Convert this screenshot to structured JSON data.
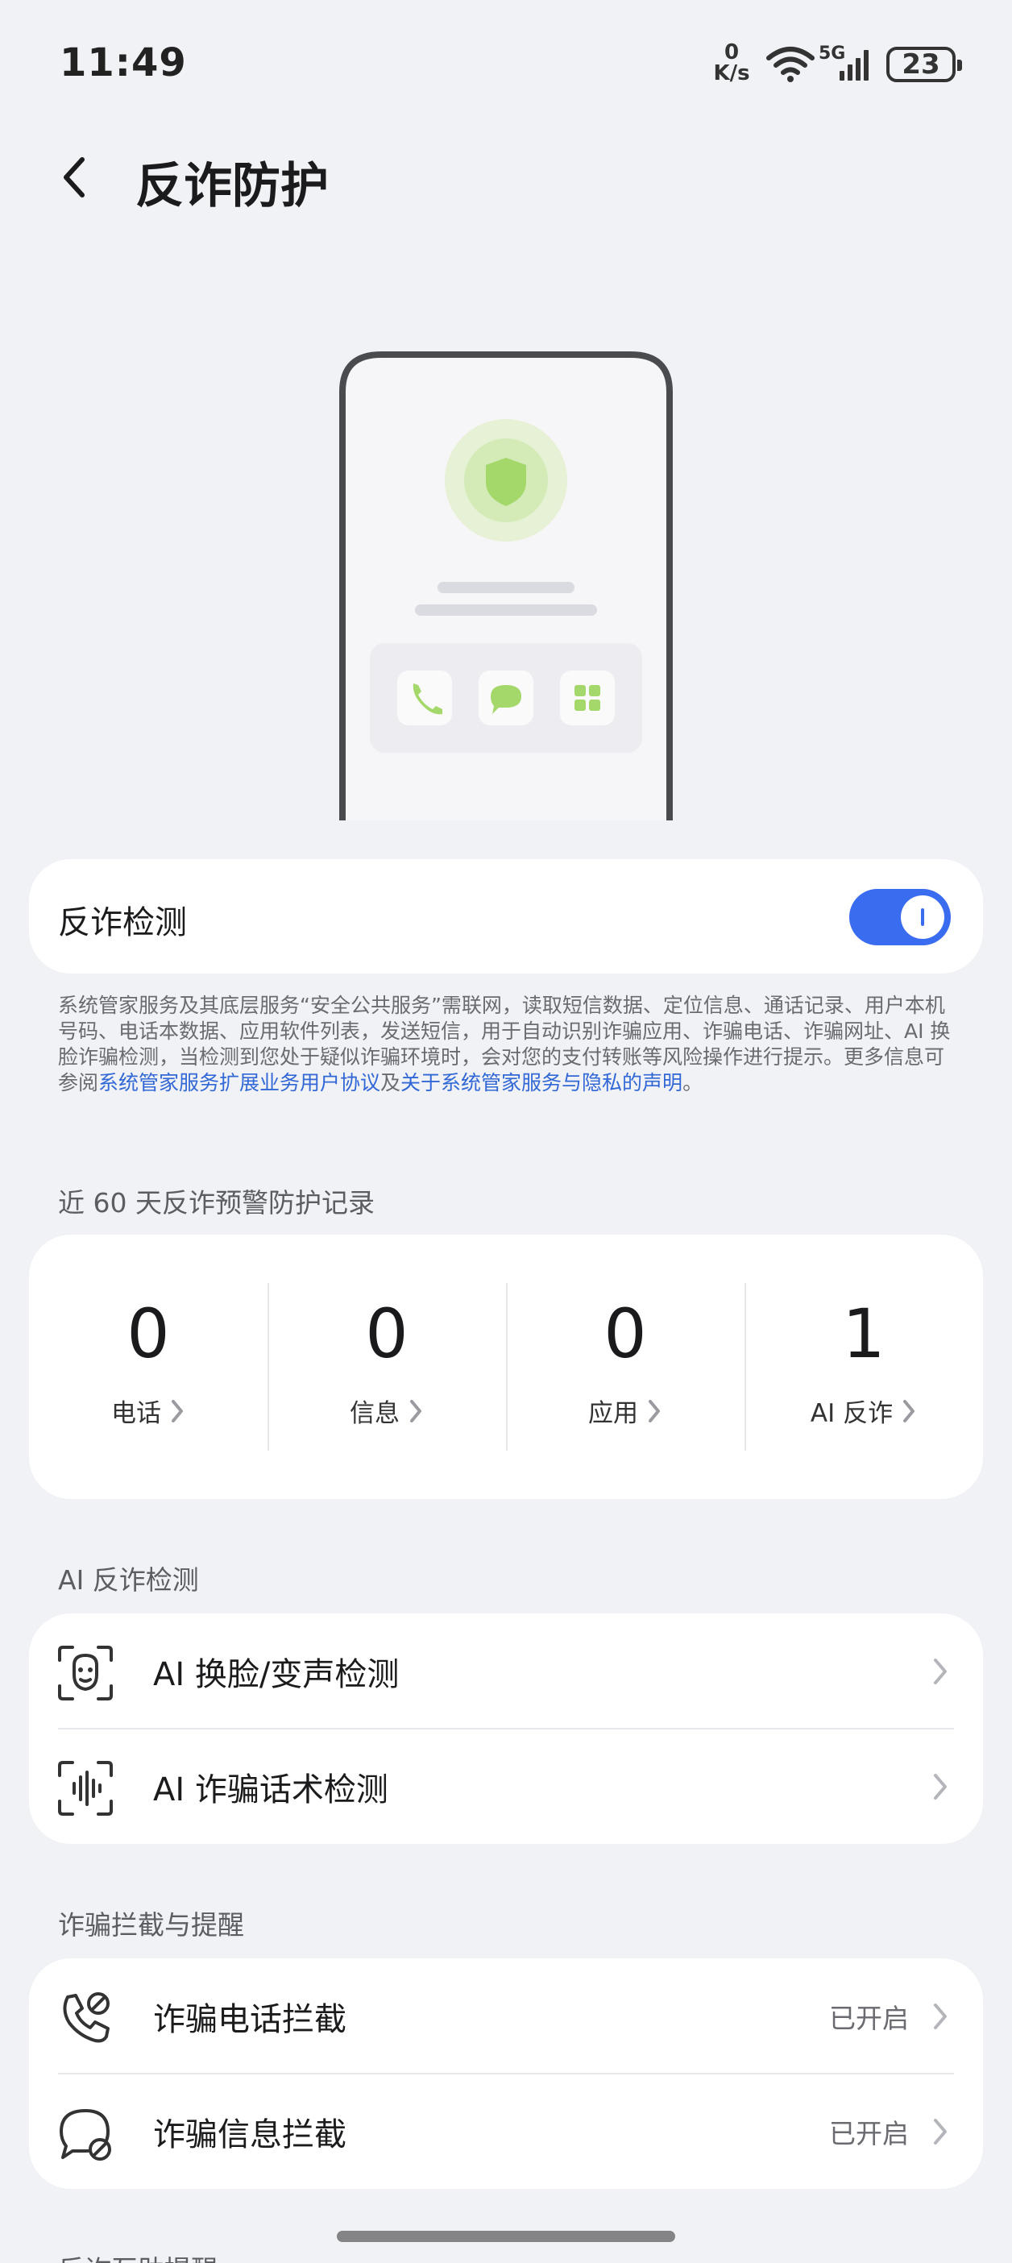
{
  "status_bar": {
    "time": "11:49",
    "speed_value": "0",
    "speed_unit": "K/s",
    "network": "5G",
    "battery": "23"
  },
  "header": {
    "title": "反诈防护"
  },
  "anti_fraud_detection": {
    "label": "反诈检测",
    "enabled": true,
    "desc_text": "系统管家服务及其底层服务“安全公共服务”需联网，读取短信数据、定位信息、通话记录、用户本机号码、电话本数据、应用软件列表，发送短信，用于自动识别诈骗应用、诈骗电话、诈骗网址、AI 换脸诈骗检测，当检测到您处于疑似诈骗环境时，会对您的支付转账等风险操作进行提示。更多信息可参阅",
    "link_agreement": "系统管家服务扩展业务用户协议",
    "and_text": "及",
    "link_privacy": "关于系统管家服务与隐私的声明",
    "end_text": "。"
  },
  "records": {
    "section_title": "近 60 天反诈预警防护记录",
    "items": [
      {
        "value": "0",
        "label": "电话"
      },
      {
        "value": "0",
        "label": "信息"
      },
      {
        "value": "0",
        "label": "应用"
      },
      {
        "value": "1",
        "label": "AI 反诈"
      }
    ]
  },
  "ai_detection": {
    "section_title": "AI 反诈检测",
    "items": [
      {
        "label": "AI 换脸/变声检测",
        "icon": "face-scan-icon"
      },
      {
        "label": "AI 诈骗话术检测",
        "icon": "voice-wave-icon"
      }
    ]
  },
  "interception": {
    "section_title": "诈骗拦截与提醒",
    "items": [
      {
        "label": "诈骗电话拦截",
        "value": "已开启",
        "icon": "phone-block-icon"
      },
      {
        "label": "诈骗信息拦截",
        "value": "已开启",
        "icon": "message-block-icon"
      }
    ]
  },
  "next_section_title": "反诈互助提醒",
  "colors": {
    "accent": "#3a6cf0",
    "link": "#3268d6",
    "background": "#f1f2f6",
    "shield_green": "#a5d86a"
  }
}
